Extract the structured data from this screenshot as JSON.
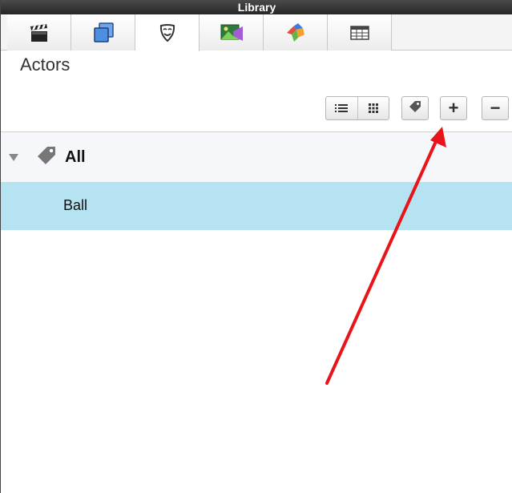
{
  "window": {
    "title": "Library"
  },
  "tabs": [
    {
      "icon": "clapperboard-icon",
      "active": false
    },
    {
      "icon": "layers-icon",
      "active": false
    },
    {
      "icon": "actor-mask-icon",
      "active": true
    },
    {
      "icon": "image-video-icon",
      "active": false
    },
    {
      "icon": "puzzle-icon",
      "active": false
    },
    {
      "icon": "table-icon",
      "active": false
    }
  ],
  "section": {
    "title": "Actors"
  },
  "toolbar": {
    "list_view_icon": "list-view-icon",
    "grid_view_icon": "grid-view-icon",
    "tag_icon": "tag-icon",
    "add_label": "+",
    "remove_label": "−"
  },
  "tree": {
    "group_label": "All",
    "items": [
      {
        "label": "Ball",
        "selected": true
      }
    ]
  },
  "colors": {
    "selection": "#b6e3f1",
    "titlebar": "#2e2e2e",
    "annotation_arrow": "#e8141a"
  }
}
